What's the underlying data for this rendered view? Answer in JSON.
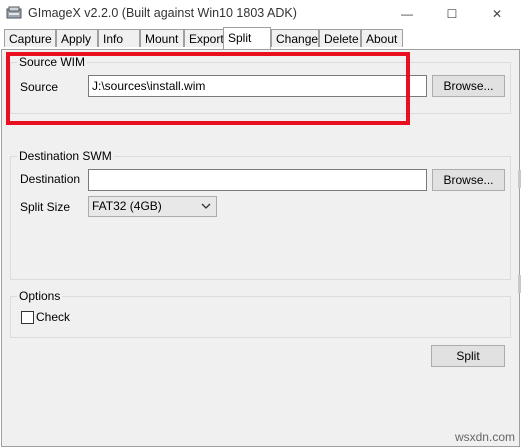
{
  "window": {
    "title": "GImageX v2.2.0 (Built against Win10 1803 ADK)",
    "controls": {
      "minimize": "—",
      "maximize": "☐",
      "close": "✕"
    }
  },
  "tabs": [
    {
      "label": "Capture"
    },
    {
      "label": "Apply"
    },
    {
      "label": "Info"
    },
    {
      "label": "Mount"
    },
    {
      "label": "Export"
    },
    {
      "label": "Split",
      "active": true
    },
    {
      "label": "Change"
    },
    {
      "label": "Delete"
    },
    {
      "label": "About"
    }
  ],
  "source_group": {
    "legend": "Source WIM",
    "source_label": "Source",
    "source_value": "J:\\sources\\install.wim",
    "browse_label": "Browse..."
  },
  "destination_group": {
    "legend": "Destination SWM",
    "destination_label": "Destination",
    "destination_value": "",
    "browse_label": "Browse...",
    "split_size_label": "Split Size",
    "split_size_value": "FAT32 (4GB)"
  },
  "options_group": {
    "legend": "Options",
    "check_label": "Check",
    "check_checked": false
  },
  "split_button_label": "Split",
  "watermark": "wsxdn.com",
  "colors": {
    "highlight": "#e8101f",
    "panel_bg": "#f0f0f0"
  }
}
